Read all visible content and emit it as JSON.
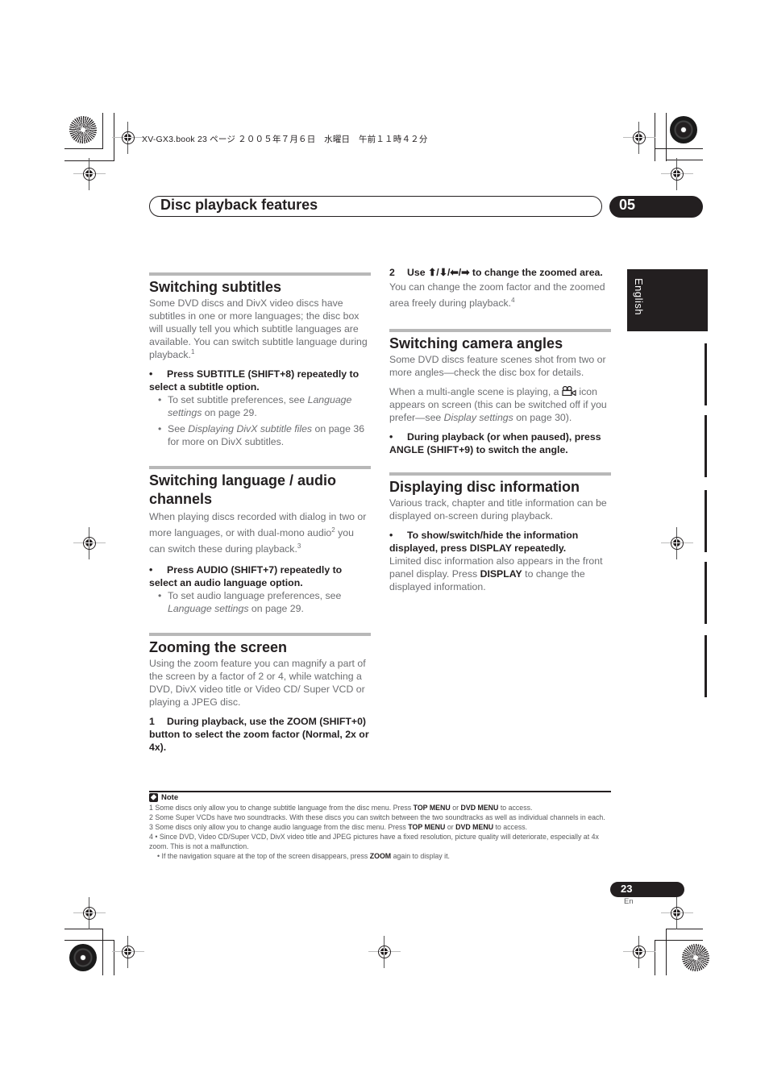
{
  "print_info": "XV-GX3.book  23 ページ  ２００５年７月６日　水曜日　午前１１時４２分",
  "header": {
    "chapter_title": "Disc playback features",
    "chapter_number": "05"
  },
  "side_tab": {
    "language": "English"
  },
  "sections": {
    "subtitles": {
      "title": "Switching subtitles",
      "body": "Some DVD discs and DivX video discs have subtitles in one or more languages; the disc box will usually tell you which subtitle languages are available. You can switch subtitle language during playback.",
      "body_footnote": "1",
      "step": "Press SUBTITLE (SHIFT+8) repeatedly to select a subtitle option.",
      "step_marker": "•",
      "sub1_pre": "To set subtitle preferences, see ",
      "sub1_ref": "Language settings",
      "sub1_post": " on page 29.",
      "sub2_pre": "See ",
      "sub2_ref": "Displaying DivX subtitle files",
      "sub2_post": " on page 36 for more on DivX subtitles."
    },
    "audio": {
      "title": "Switching language / audio channels",
      "body_1": "When playing discs recorded with dialog in two or more languages, or with dual-mono audio",
      "footnote_1": "2",
      "body_2": " you can switch these during playback.",
      "footnote_2": "3",
      "step_marker": "•",
      "step": "Press AUDIO (SHIFT+7) repeatedly to select an audio language option.",
      "sub1_pre": "To set audio language preferences, see ",
      "sub1_ref": "Language settings",
      "sub1_post": " on page 29."
    },
    "zoom": {
      "title": "Zooming the screen",
      "body": "Using the zoom feature you can magnify a part of the screen by a factor of 2 or 4, while watching a DVD, DivX video title or Video CD/ Super VCD or playing a JPEG disc.",
      "step1_num": "1",
      "step1": "During playback, use the ZOOM (SHIFT+0) button to select the zoom factor (Normal, 2x or 4x).",
      "step2_num": "2",
      "step2_pre": "Use ",
      "step2_arrows": "⬆/⬇/⬅/➡",
      "step2_post": " to change the zoomed area.",
      "step2_body": "You can change the zoom factor and the zoomed area freely during playback.",
      "step2_footnote": "4"
    },
    "angles": {
      "title": "Switching camera angles",
      "body_1": "Some DVD discs feature scenes shot from two or more angles—check the disc box for details.",
      "body_2_pre": "When a multi-angle scene is playing, a ",
      "body_2_mid": " icon appears on screen (this can be switched off if you prefer—see ",
      "body_2_ref": "Display settings",
      "body_2_post": " on page 30).",
      "step_marker": "•",
      "step": "During playback (or when paused), press ANGLE (SHIFT+9) to switch the angle."
    },
    "disc_info": {
      "title": "Displaying disc information",
      "body": "Various track, chapter and title information can be displayed on-screen during playback.",
      "step_marker": "•",
      "step": "To show/switch/hide the information displayed, press DISPLAY repeatedly.",
      "body_2_pre": "Limited disc information also appears in the front panel display. Press ",
      "body_2_key": "DISPLAY",
      "body_2_post": " to change the displayed information."
    }
  },
  "notes": {
    "heading": "Note",
    "n1_pre": "1 Some discs only allow you to change subtitle language from the disc menu. Press ",
    "n1_k1": "TOP MENU",
    "n1_mid": " or ",
    "n1_k2": "DVD MENU",
    "n1_post": " to access.",
    "n2": "2 Some Super VCDs have two soundtracks. With these discs you can switch between the two soundtracks as well as individual channels in each.",
    "n3_pre": "3 Some discs only allow you to change audio language from the disc menu. Press ",
    "n3_k1": "TOP MENU",
    "n3_mid": " or ",
    "n3_k2": "DVD MENU",
    "n3_post": " to access.",
    "n4a": "4  • Since DVD, Video CD/Super VCD, DivX video title and JPEG pictures have a fixed resolution, picture quality will deteriorate, especially at 4x zoom. This is not a malfunction.",
    "n4b_pre": "• If the navigation square at the top of the screen disappears, press ",
    "n4b_key": "ZOOM",
    "n4b_post": " again to display it."
  },
  "footer": {
    "page_number": "23",
    "page_lang": "En"
  }
}
